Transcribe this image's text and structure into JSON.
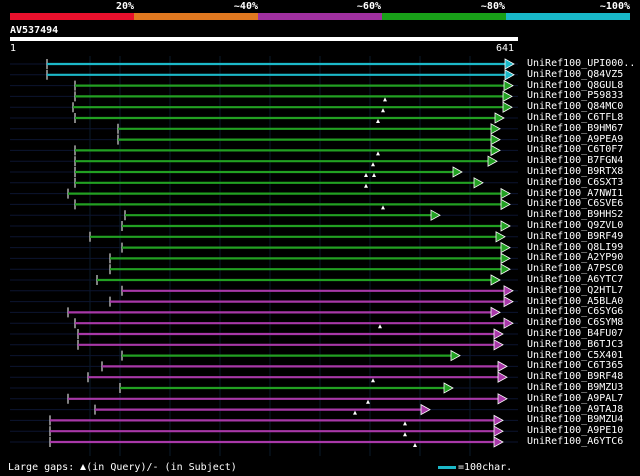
{
  "legend": {
    "labels": [
      "20%",
      "~40%",
      "~60%",
      "~80%",
      "~100%"
    ],
    "colors": [
      "#e8102c",
      "#e07820",
      "#a030a0",
      "#18a018",
      "#18b8c8"
    ]
  },
  "query": {
    "id": "AV537494",
    "start": "1",
    "end": "641"
  },
  "colors": {
    "cyan": "#1cb8c8",
    "green": "#22a022",
    "purple": "#a838a8"
  },
  "hits": [
    {
      "name": "UniRef100_UPI000..",
      "color": "cyan",
      "start": 47,
      "end": 514,
      "gaps": []
    },
    {
      "name": "UniRef100_Q84VZ5",
      "color": "cyan",
      "start": 47,
      "end": 514,
      "gaps": []
    },
    {
      "name": "UniRef100_Q8GUL8",
      "color": "green",
      "start": 75,
      "end": 513,
      "gaps": []
    },
    {
      "name": "UniRef100_P59833",
      "color": "green",
      "start": 75,
      "end": 512,
      "gaps": [
        385
      ]
    },
    {
      "name": "UniRef100_Q84MC0",
      "color": "green",
      "start": 73,
      "end": 512,
      "gaps": [
        383
      ]
    },
    {
      "name": "UniRef100_C6TFL8",
      "color": "green",
      "start": 75,
      "end": 504,
      "gaps": [
        378
      ]
    },
    {
      "name": "UniRef100_B9HM67",
      "color": "green",
      "start": 118,
      "end": 500,
      "gaps": []
    },
    {
      "name": "UniRef100_A9PEA9",
      "color": "green",
      "start": 118,
      "end": 500,
      "gaps": []
    },
    {
      "name": "UniRef100_C6T0F7",
      "color": "green",
      "start": 75,
      "end": 500,
      "gaps": [
        378
      ]
    },
    {
      "name": "UniRef100_B7FGN4",
      "color": "green",
      "start": 75,
      "end": 497,
      "gaps": [
        373
      ]
    },
    {
      "name": "UniRef100_B9RTX8",
      "color": "green",
      "start": 75,
      "end": 462,
      "gaps": [
        366,
        374
      ]
    },
    {
      "name": "UniRef100_C6SXT3",
      "color": "green",
      "start": 75,
      "end": 483,
      "gaps": [
        366
      ]
    },
    {
      "name": "UniRef100_A7NWI1",
      "color": "green",
      "start": 68,
      "end": 510,
      "gaps": []
    },
    {
      "name": "UniRef100_C6SVE6",
      "color": "green",
      "start": 75,
      "end": 510,
      "gaps": [
        383
      ]
    },
    {
      "name": "UniRef100_B9HHS2",
      "color": "green",
      "start": 125,
      "end": 440,
      "gaps": []
    },
    {
      "name": "UniRef100_Q9ZVL0",
      "color": "green",
      "start": 122,
      "end": 510,
      "gaps": []
    },
    {
      "name": "UniRef100_B9RF49",
      "color": "green",
      "start": 90,
      "end": 505,
      "gaps": []
    },
    {
      "name": "UniRef100_Q8LI99",
      "color": "green",
      "start": 122,
      "end": 510,
      "gaps": []
    },
    {
      "name": "UniRef100_A2YP90",
      "color": "green",
      "start": 110,
      "end": 510,
      "gaps": []
    },
    {
      "name": "UniRef100_A7PSC0",
      "color": "green",
      "start": 110,
      "end": 510,
      "gaps": []
    },
    {
      "name": "UniRef100_A6YTC7",
      "color": "green",
      "start": 97,
      "end": 500,
      "gaps": []
    },
    {
      "name": "UniRef100_Q2HTL7",
      "color": "purple",
      "start": 122,
      "end": 513,
      "gaps": []
    },
    {
      "name": "UniRef100_A5BLA0",
      "color": "purple",
      "start": 110,
      "end": 513,
      "gaps": []
    },
    {
      "name": "UniRef100_C6SYG6",
      "color": "purple",
      "start": 68,
      "end": 500,
      "gaps": []
    },
    {
      "name": "UniRef100_C6SYM8",
      "color": "purple",
      "start": 75,
      "end": 513,
      "gaps": [
        380
      ]
    },
    {
      "name": "UniRef100_B4FU07",
      "color": "purple",
      "start": 78,
      "end": 503,
      "gaps": []
    },
    {
      "name": "UniRef100_B6TJC3",
      "color": "purple",
      "start": 78,
      "end": 503,
      "gaps": []
    },
    {
      "name": "UniRef100_C5X401",
      "color": "green",
      "start": 122,
      "end": 460,
      "gaps": []
    },
    {
      "name": "UniRef100_C6T365",
      "color": "purple",
      "start": 102,
      "end": 507,
      "gaps": []
    },
    {
      "name": "UniRef100_B9RF48",
      "color": "purple",
      "start": 88,
      "end": 507,
      "gaps": [
        373
      ]
    },
    {
      "name": "UniRef100_B9MZU3",
      "color": "green",
      "start": 120,
      "end": 453,
      "gaps": []
    },
    {
      "name": "UniRef100_A9PAL7",
      "color": "purple",
      "start": 68,
      "end": 507,
      "gaps": [
        368
      ]
    },
    {
      "name": "UniRef100_A9TAJ8",
      "color": "purple",
      "start": 95,
      "end": 430,
      "gaps": [
        355
      ]
    },
    {
      "name": "UniRef100_B9MZU4",
      "color": "purple",
      "start": 50,
      "end": 503,
      "gaps": [
        405
      ]
    },
    {
      "name": "UniRef100_A9PE10",
      "color": "purple",
      "start": 50,
      "end": 503,
      "gaps": [
        405
      ]
    },
    {
      "name": "UniRef100_A6YTC6",
      "color": "purple",
      "start": 50,
      "end": 503,
      "gaps": [
        415
      ]
    }
  ],
  "footer": {
    "large_gaps_prefix": "Large gaps:",
    "in_query": "(in Query)/",
    "dash": "-",
    "in_subject": " (in Subject)",
    "scale_label": "=100char."
  }
}
